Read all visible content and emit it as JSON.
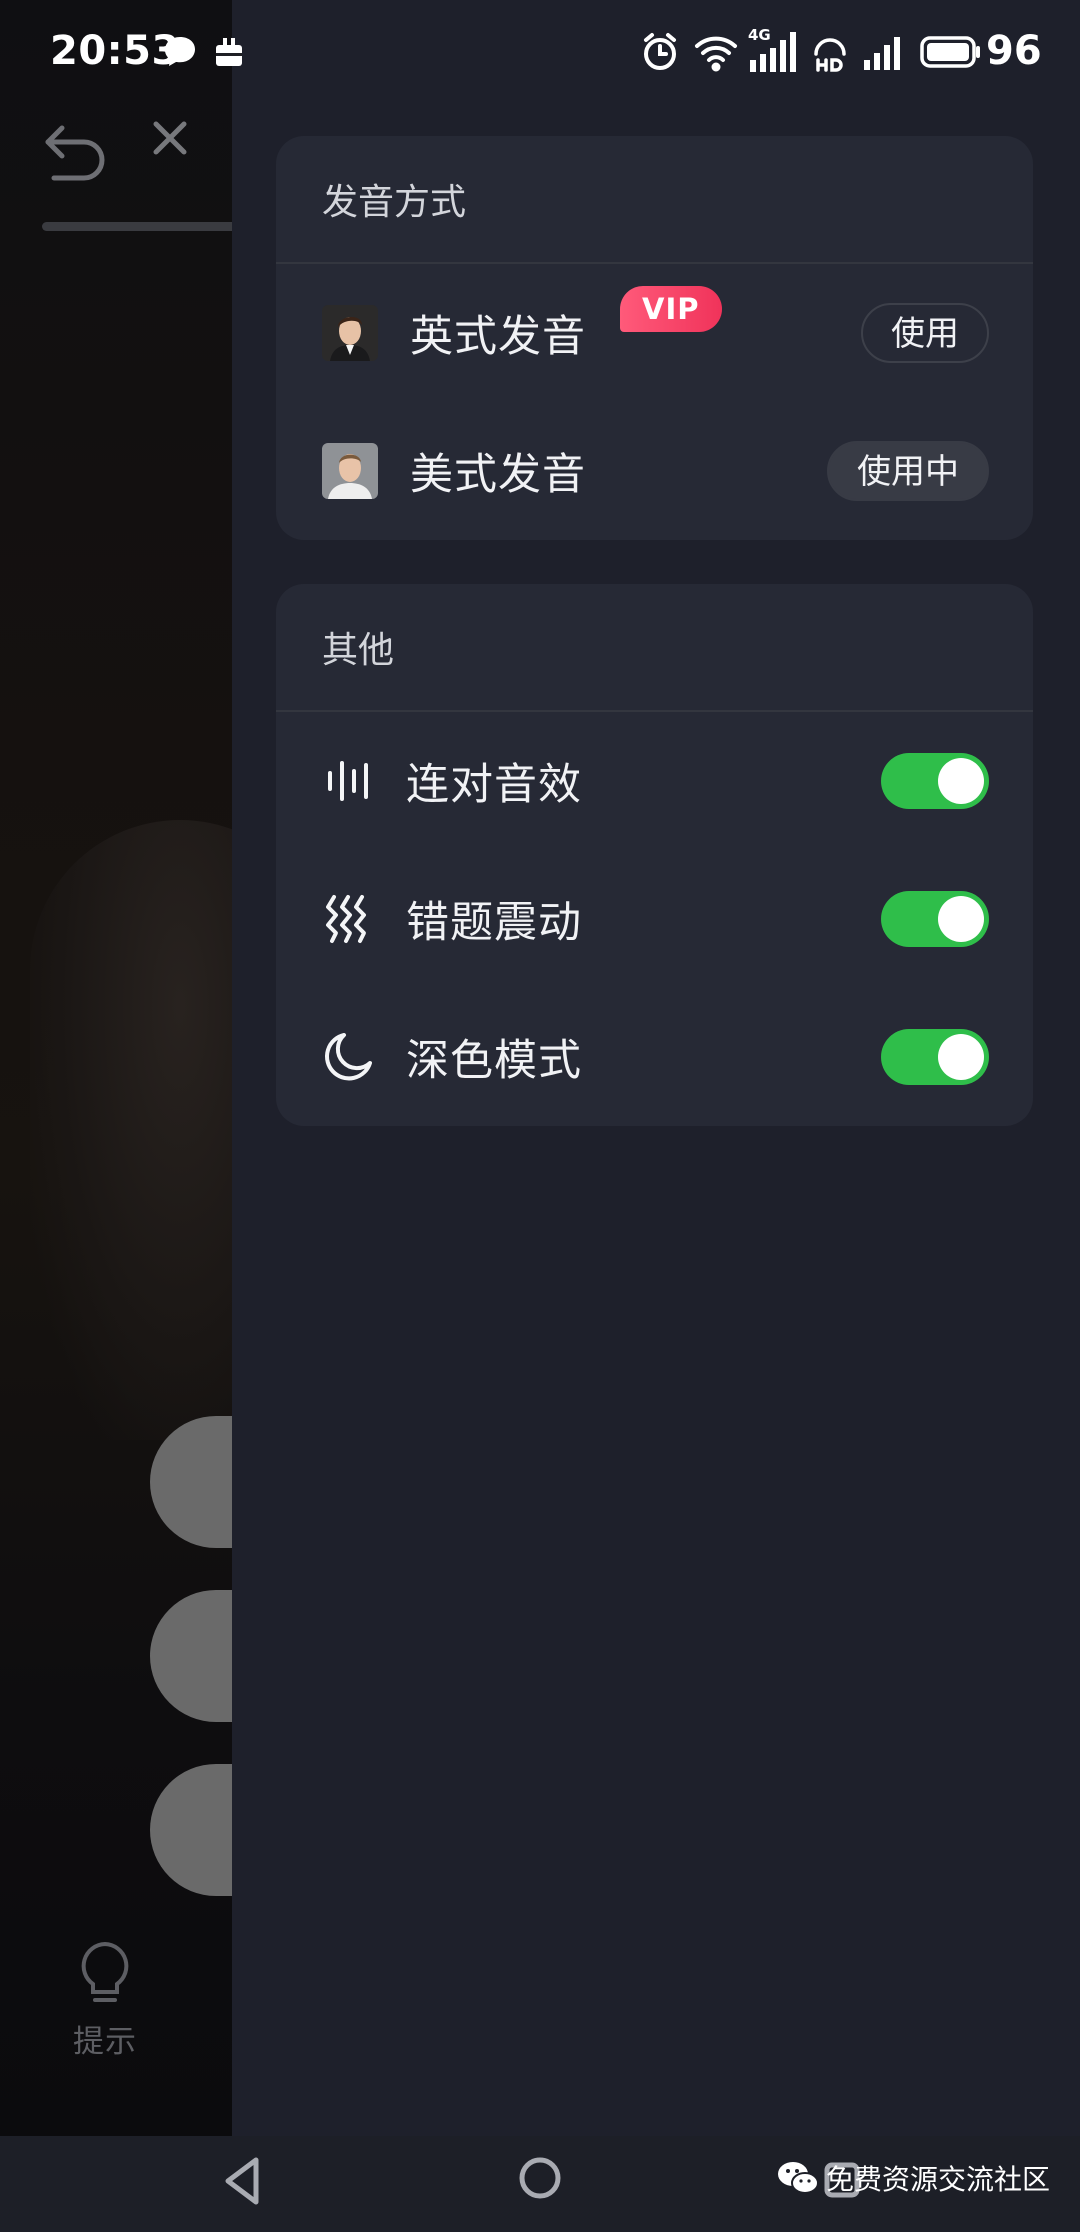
{
  "status_bar": {
    "time": "20:53",
    "network_label": "4G",
    "battery_level": "96"
  },
  "background_page": {
    "hint_label": "提示"
  },
  "pronunciation": {
    "title": "发音方式",
    "vip_badge": "VIP",
    "options": [
      {
        "label": "英式发音",
        "button": "使用",
        "selected": false
      },
      {
        "label": "美式发音",
        "button": "使用中",
        "selected": true
      }
    ]
  },
  "other": {
    "title": "其他",
    "settings": [
      {
        "label": "连对音效",
        "icon": "sound-wave-icon",
        "enabled": true
      },
      {
        "label": "错题震动",
        "icon": "vibration-icon",
        "enabled": true
      },
      {
        "label": "深色模式",
        "icon": "moon-icon",
        "enabled": true
      }
    ]
  },
  "watermark": {
    "text": "免费资源交流社区"
  },
  "colors": {
    "toggle_on": "#2fbe4a",
    "vip_badge": "#f0335a",
    "card_bg": "#262935",
    "drawer_bg": "#1e202b"
  }
}
